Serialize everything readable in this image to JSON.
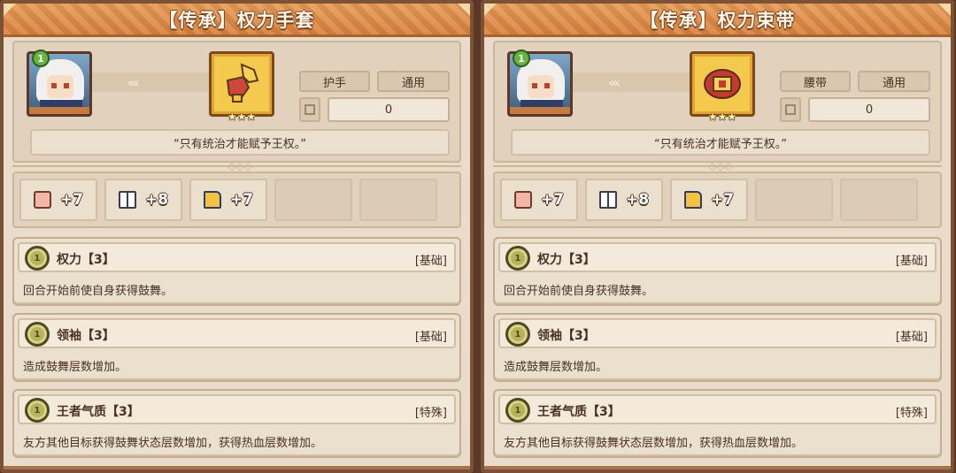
{
  "cards": [
    {
      "title": "【传承】权力手套",
      "level": "1",
      "item_icon": "gauntlet-icon",
      "stars": "★★★",
      "tags": [
        "护手",
        "通用"
      ],
      "slot_value": "0",
      "quote": "“只有统治才能赋予王权。”",
      "stats": [
        {
          "icon": "fist-icon",
          "value": "+7"
        },
        {
          "icon": "book-icon",
          "value": "+8"
        },
        {
          "icon": "boot-icon",
          "value": "+7"
        }
      ],
      "skills": [
        {
          "name": "权力【3】",
          "type": "[基础]",
          "desc": "回合开始前使自身获得鼓舞。"
        },
        {
          "name": "领袖【3】",
          "type": "[基础]",
          "desc": "造成鼓舞层数增加。"
        },
        {
          "name": "王者气质【3】",
          "type": "[特殊]",
          "desc": "友方其他目标获得鼓舞状态层数增加，获得热血层数增加。"
        }
      ]
    },
    {
      "title": "【传承】权力束带",
      "level": "1",
      "item_icon": "belt-icon",
      "stars": "★★★",
      "tags": [
        "腰带",
        "通用"
      ],
      "slot_value": "0",
      "quote": "“只有统治才能赋予王权。”",
      "stats": [
        {
          "icon": "fist-icon",
          "value": "+7"
        },
        {
          "icon": "book-icon",
          "value": "+8"
        },
        {
          "icon": "boot-icon",
          "value": "+7"
        }
      ],
      "skills": [
        {
          "name": "权力【3】",
          "type": "[基础]",
          "desc": "回合开始前使自身获得鼓舞。"
        },
        {
          "name": "领袖【3】",
          "type": "[基础]",
          "desc": "造成鼓舞层数增加。"
        },
        {
          "name": "王者气质【3】",
          "type": "[特殊]",
          "desc": "友方其他目标获得鼓舞状态层数增加，获得热血层数增加。"
        }
      ]
    }
  ],
  "colors": {
    "title_bar": "#d8803c",
    "panel": "#e9dccb",
    "frame": "#7b5236",
    "level_badge": "#67b43e",
    "item_frame": "#f3c94e"
  }
}
